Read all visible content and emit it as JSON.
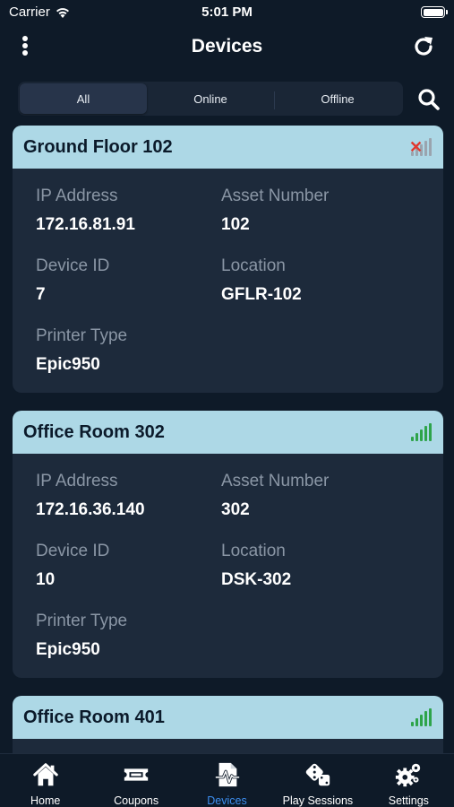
{
  "status_bar": {
    "carrier": "Carrier",
    "time": "5:01 PM"
  },
  "nav": {
    "title": "Devices"
  },
  "filter": {
    "tabs": [
      "All",
      "Online",
      "Offline"
    ],
    "selected": "All"
  },
  "devices": [
    {
      "name": "Ground Floor 102",
      "status": "offline",
      "labels": {
        "ip": "IP Address",
        "asset": "Asset Number",
        "device_id": "Device ID",
        "location": "Location",
        "printer": "Printer Type"
      },
      "ip": "172.16.81.91",
      "asset_number": "102",
      "device_id": "7",
      "location": "GFLR-102",
      "printer_type": "Epic950"
    },
    {
      "name": "Office Room 302",
      "status": "online",
      "labels": {
        "ip": "IP Address",
        "asset": "Asset Number",
        "device_id": "Device ID",
        "location": "Location",
        "printer": "Printer Type"
      },
      "ip": "172.16.36.140",
      "asset_number": "302",
      "device_id": "10",
      "location": "DSK-302",
      "printer_type": "Epic950"
    },
    {
      "name": "Office Room 401",
      "status": "online"
    }
  ],
  "tab_bar": {
    "items": [
      {
        "label": "Home",
        "icon": "home-icon"
      },
      {
        "label": "Coupons",
        "icon": "ticket-icon"
      },
      {
        "label": "Devices",
        "icon": "device-pulse-icon"
      },
      {
        "label": "Play Sessions",
        "icon": "dice-icon"
      },
      {
        "label": "Settings",
        "icon": "gears-icon"
      }
    ],
    "active": "Devices"
  },
  "colors": {
    "background": "#0e1a28",
    "card": "#1d2a3b",
    "card_header": "#add8e6",
    "accent": "#3d8ff0",
    "online": "#2ea44a",
    "offline": "#e0392f"
  }
}
